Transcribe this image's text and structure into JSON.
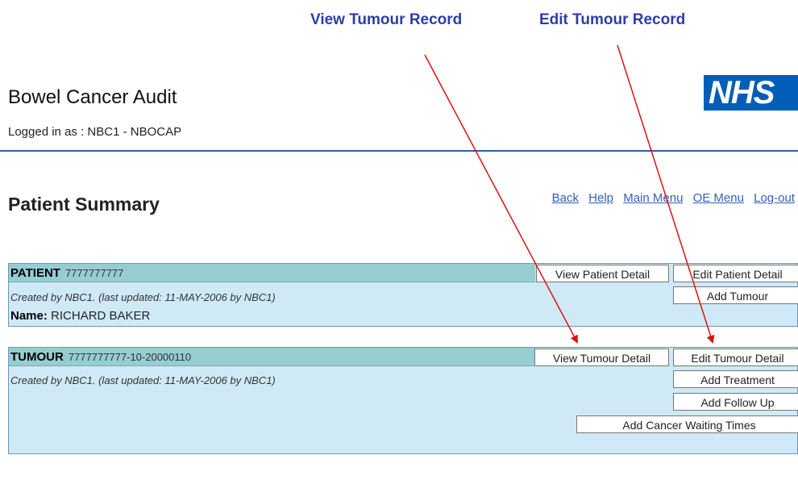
{
  "callouts": {
    "view": "View Tumour Record",
    "edit": "Edit Tumour Record"
  },
  "header": {
    "app_title": "Bowel Cancer Audit",
    "logged_in_prefix": "Logged in as :",
    "logged_in_user": "NBC1 - NBOCAP",
    "logo_text": "NHS"
  },
  "nav": {
    "links": [
      "Back",
      "Help",
      "Main Menu",
      "OE Menu",
      "Log-out"
    ]
  },
  "page_title": "Patient Summary",
  "patient": {
    "label": "PATIENT",
    "id": "7777777777",
    "created": "Created by NBC1.  (last updated: 11-MAY-2006 by NBC1)",
    "name_label": "Name:",
    "name_value": "RICHARD BAKER",
    "buttons": {
      "view": "View Patient Detail",
      "edit": "Edit Patient Detail",
      "add_tumour": "Add Tumour"
    }
  },
  "tumour": {
    "label": "TUMOUR",
    "id": "7777777777-10-20000110",
    "created": "Created by NBC1.  (last updated: 11-MAY-2006 by NBC1)",
    "buttons": {
      "view": "View Tumour Detail",
      "edit": "Edit Tumour Detail",
      "add_treatment": "Add Treatment",
      "add_followup": "Add Follow Up",
      "add_cwt": "Add Cancer Waiting Times"
    }
  },
  "colors": {
    "accent": "#2d3ea8",
    "panel": "#cfe9f7",
    "panel_bar": "#95cdd2",
    "arrow": "#e01010",
    "nhs_blue": "#005eb8"
  }
}
